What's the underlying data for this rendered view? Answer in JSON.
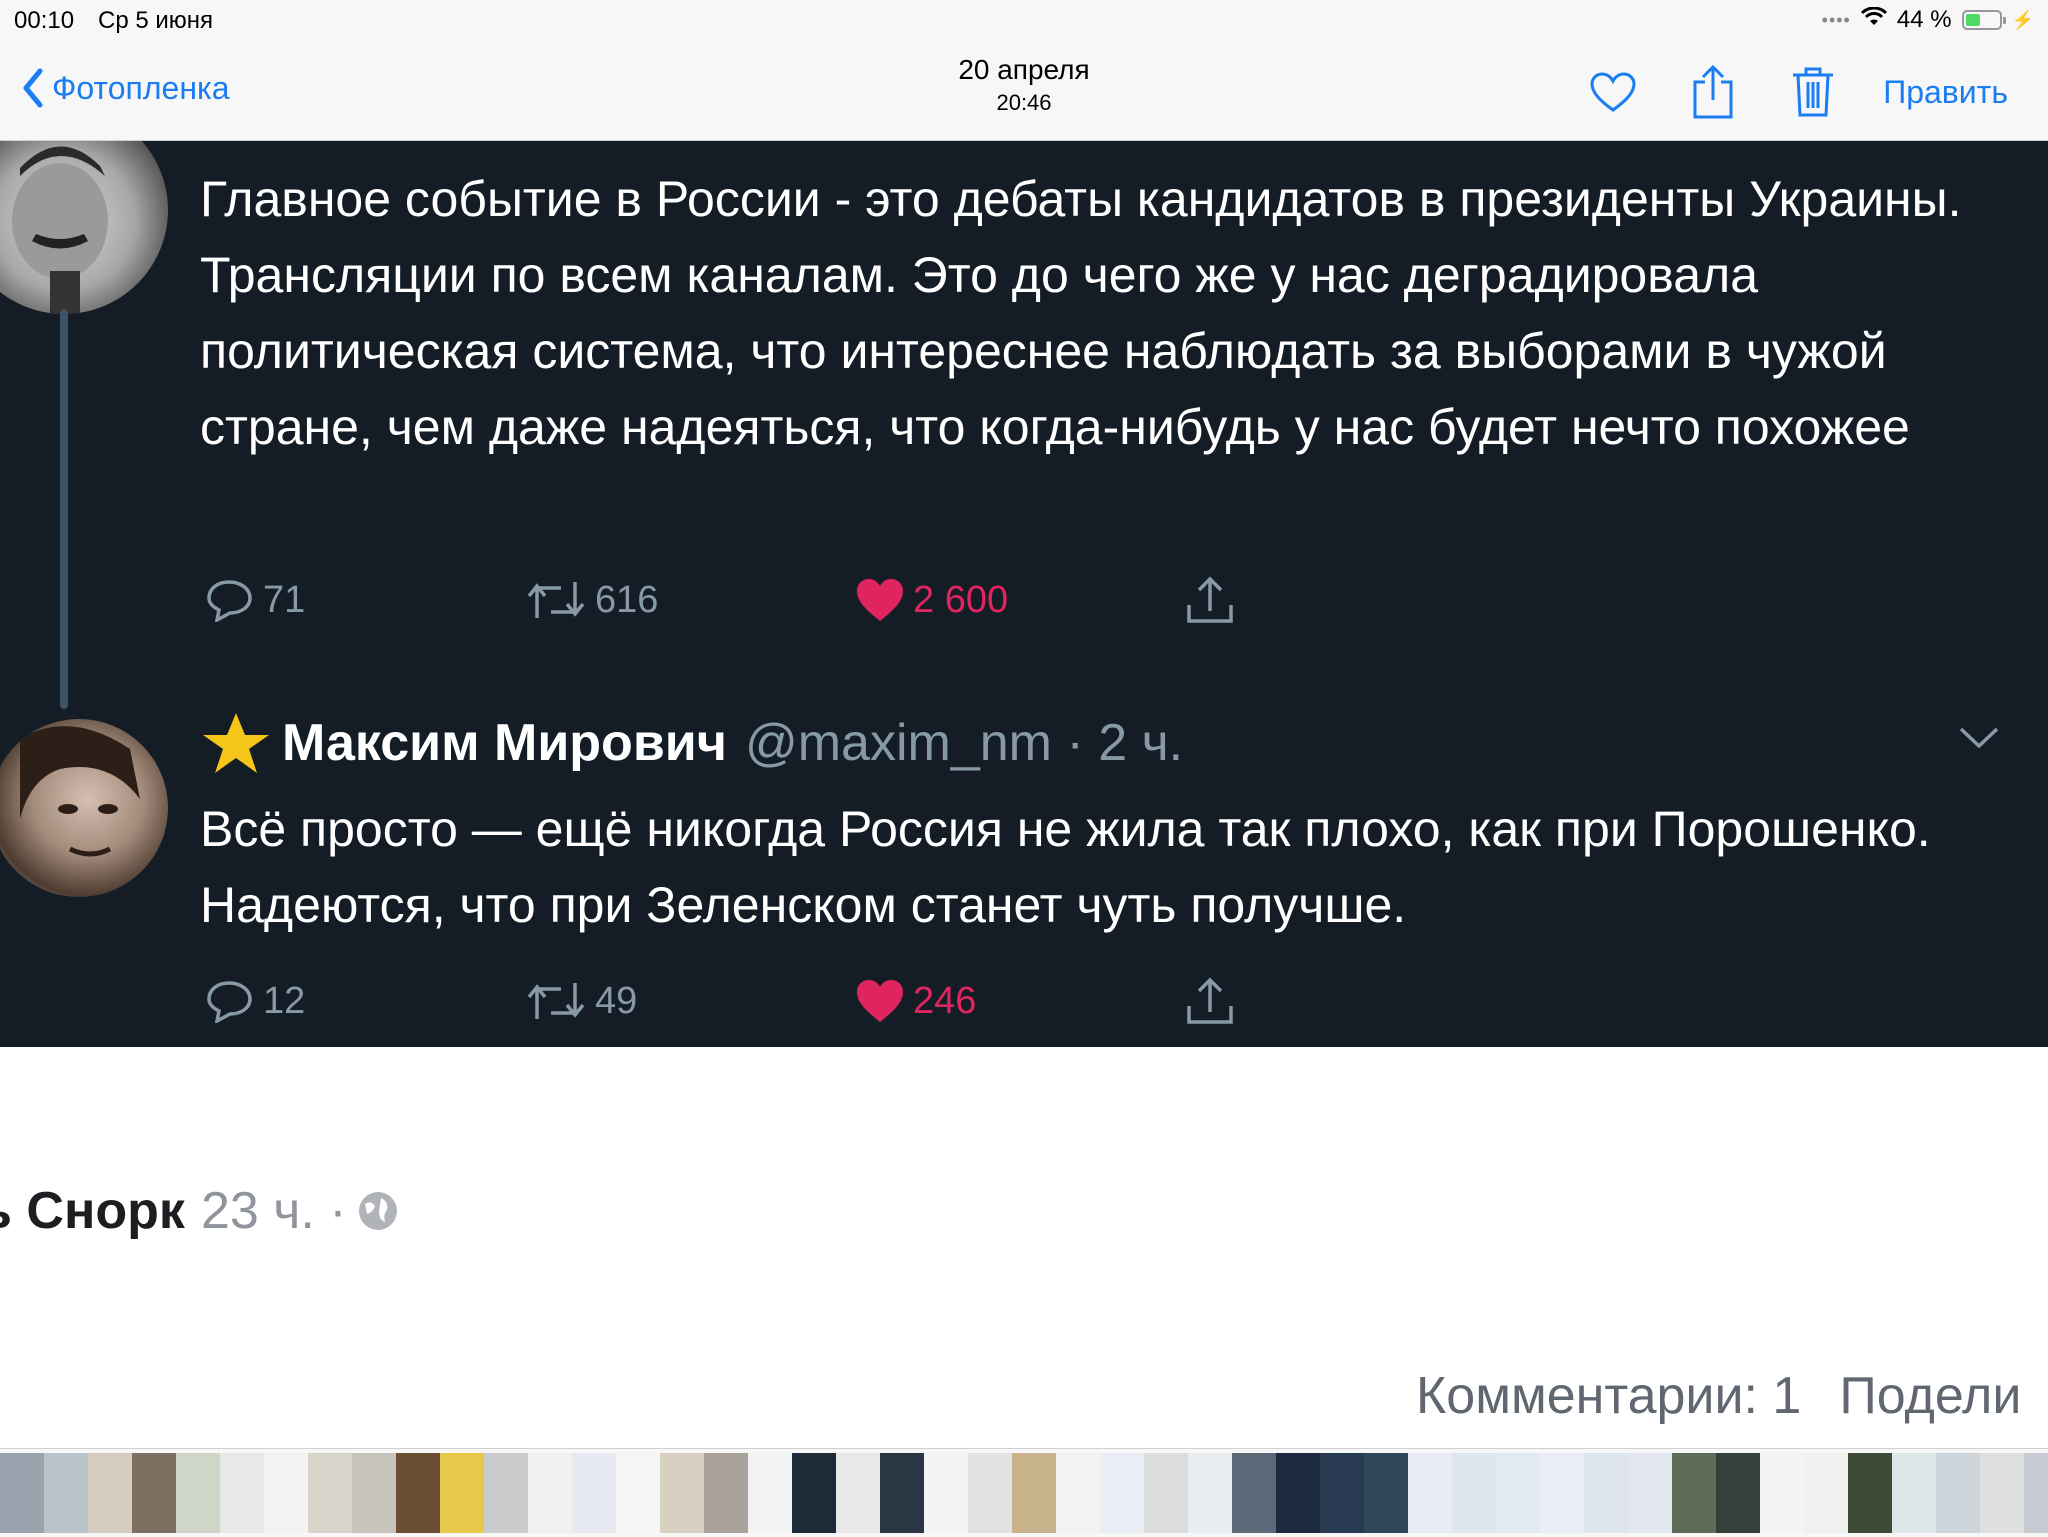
{
  "status": {
    "time": "00:10",
    "date": "Ср 5 июня",
    "battery": "44 %",
    "battery_level": 0.44
  },
  "nav": {
    "back_label": "Фотопленка",
    "title_date": "20 апреля",
    "title_time": "20:46",
    "edit_label": "Править",
    "icons": [
      "heart-icon",
      "share-icon",
      "trash-icon"
    ]
  },
  "tweets": [
    {
      "text": "Главное событие в России - это дебаты кандидатов в президенты Украины. Трансляции по всем каналам. Это до чего же у нас деградировала политическая система, что интереснее наблюдать за выборами в чужой стране, чем даже надеяться, что когда-нибудь у нас будет нечто похожее",
      "replies": "71",
      "retweets": "616",
      "likes": "2 600"
    },
    {
      "name": "Максим Мирович",
      "handle": "@maxim_nm · 2 ч.",
      "text": "Всё просто — ещё никогда Россия не жила так плохо, как при Порошенко. Надеются, что при Зеленском станет чуть получше.",
      "replies": "12",
      "retweets": "49",
      "likes": "246"
    }
  ],
  "post": {
    "author_partial": "ь Снорк",
    "time": "23 ч. ·",
    "comments": "Комментарии: 1",
    "share_partial": "Подели"
  },
  "colors": {
    "accent": "#1a7df2",
    "tweet_bg": "#141d26",
    "like": "#e0245e",
    "muted": "#8899a6"
  },
  "thumbnails": [
    "#9aa3ad",
    "#b9c4c9",
    "#d5ccbf",
    "#7e7060",
    "#cfd6c7",
    "#e8e8e8",
    "#f2f2f2",
    "#d9d4c9",
    "#c8c4bc",
    "#6a4d33",
    "#e6c84b",
    "#cbcbcb",
    "#f0f0f0",
    "#e7eaf0",
    "#f5f5f5",
    "#d8d0c0",
    "#aaa39b",
    "#f3f3f3",
    "#1e2b38",
    "#e8e8e8",
    "#2a3644",
    "#f4f4f4",
    "#e2e2e2",
    "#c8b28b",
    "#f2f2f2",
    "#e9eef5",
    "#dcdcdc",
    "#e8edf2",
    "#5b6a78",
    "#1c2a3e",
    "#273a52",
    "#2f4858",
    "#e6ecf2",
    "#dfe6ee",
    "#e3e9f0",
    "#e8eef4",
    "#dde4ec",
    "#e2e8ee",
    "#5e6b57",
    "#36403a",
    "#f4f4f4",
    "#f0f0f0",
    "#3d4a36",
    "#dfe6ea",
    "#cdd5da",
    "#e0e0e0",
    "#c5cbd0"
  ]
}
